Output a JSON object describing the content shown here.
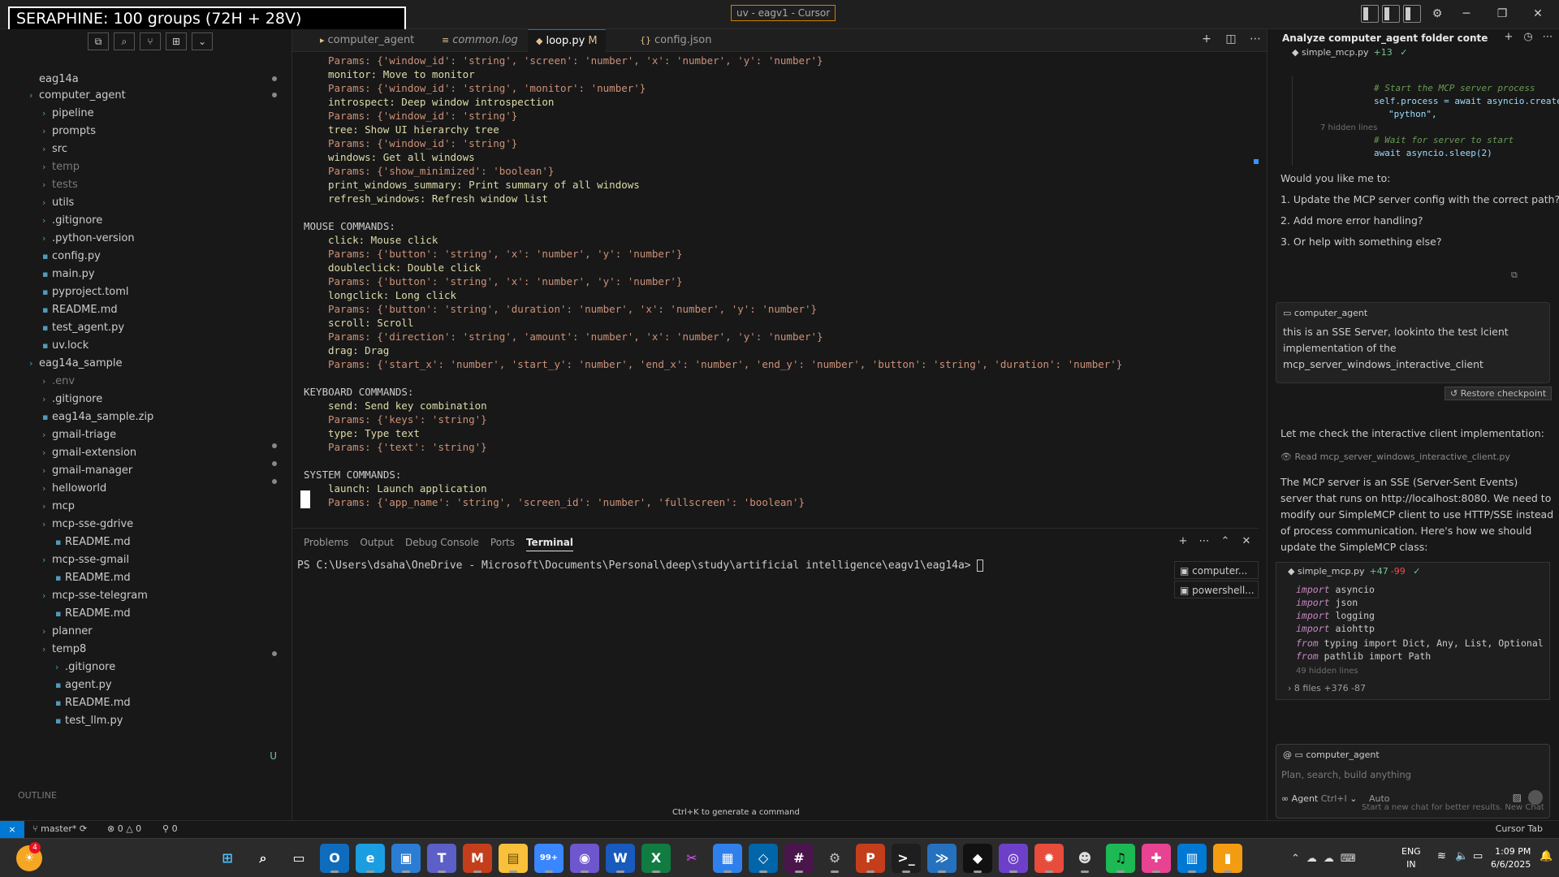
{
  "overlay_title": "SERAPHINE: 100 groups (72H + 28V)",
  "window_title": "uv - eagv1 - Cursor",
  "explorer": {
    "root": "eag14a",
    "items": [
      {
        "label": "computer_agent",
        "muted": false
      },
      {
        "label": "pipeline",
        "muted": false
      },
      {
        "label": "prompts",
        "muted": false
      },
      {
        "label": "src",
        "muted": false
      },
      {
        "label": "temp",
        "muted": true
      },
      {
        "label": "tests",
        "muted": true
      },
      {
        "label": "utils",
        "muted": false
      },
      {
        "label": ".gitignore",
        "muted": false
      },
      {
        "label": ".python-version",
        "muted": false
      },
      {
        "label": "config.py",
        "muted": false
      },
      {
        "label": "main.py",
        "muted": false
      },
      {
        "label": "pyproject.toml",
        "muted": false
      },
      {
        "label": "README.md",
        "muted": false
      },
      {
        "label": "test_agent.py",
        "muted": false
      },
      {
        "label": "uv.lock",
        "muted": false
      },
      {
        "label": "eag14a_sample",
        "muted": false
      },
      {
        "label": ".env",
        "muted": true
      },
      {
        "label": ".gitignore",
        "muted": false
      },
      {
        "label": "eag14a_sample.zip",
        "muted": false
      },
      {
        "label": "gmail-triage",
        "muted": false
      },
      {
        "label": "gmail-extension",
        "muted": false
      },
      {
        "label": "gmail-manager",
        "muted": false
      },
      {
        "label": "helloworld",
        "muted": false
      },
      {
        "label": "mcp",
        "muted": false
      },
      {
        "label": "mcp-sse-gdrive",
        "muted": false
      },
      {
        "label": "README.md",
        "muted": false
      },
      {
        "label": "mcp-sse-gmail",
        "muted": false
      },
      {
        "label": "README.md",
        "muted": false
      },
      {
        "label": "mcp-sse-telegram",
        "muted": false
      },
      {
        "label": "README.md",
        "muted": false
      },
      {
        "label": "planner",
        "muted": false
      },
      {
        "label": "temp8",
        "muted": false
      },
      {
        "label": ".gitignore",
        "muted": false
      },
      {
        "label": "agent.py",
        "muted": false
      },
      {
        "label": "README.md",
        "muted": false
      },
      {
        "label": "test_llm.py",
        "muted": false
      }
    ],
    "outline_label": "OUTLINE",
    "git_untracked": "U"
  },
  "editor_tabs": [
    {
      "label": "computer_agent",
      "active": false,
      "modified": ""
    },
    {
      "label": "common.log",
      "active": false,
      "modified": ""
    },
    {
      "label": "loop.py",
      "active": true,
      "modified": "M"
    },
    {
      "label": "config.json",
      "active": false,
      "modified": ""
    }
  ],
  "code_lines": [
    {
      "text": "Params: {'window_id': 'string', 'screen': 'number', 'x': 'number', 'y': 'number'}",
      "kind": "params"
    },
    {
      "text": "monitor: Move to monitor",
      "kind": "cmd"
    },
    {
      "text": "Params: {'window_id': 'string', 'monitor': 'number'}",
      "kind": "params"
    },
    {
      "text": "introspect: Deep window introspection",
      "kind": "cmd"
    },
    {
      "text": "Params: {'window_id': 'string'}",
      "kind": "params"
    },
    {
      "text": "tree: Show UI hierarchy tree",
      "kind": "cmd"
    },
    {
      "text": "Params: {'window_id': 'string'}",
      "kind": "params"
    },
    {
      "text": "windows: Get all windows",
      "kind": "cmd"
    },
    {
      "text": "Params: {'show_minimized': 'boolean'}",
      "kind": "params"
    },
    {
      "text": "print_windows_summary: Print summary of all windows",
      "kind": "cmd"
    },
    {
      "text": "refresh_windows: Refresh window list",
      "kind": "cmd"
    },
    {
      "text": "",
      "kind": "params"
    },
    {
      "text": "MOUSE COMMANDS:",
      "kind": "hdr"
    },
    {
      "text": "click: Mouse click",
      "kind": "cmd"
    },
    {
      "text": "Params: {'button': 'string', 'x': 'number', 'y': 'number'}",
      "kind": "params"
    },
    {
      "text": "doubleclick: Double click",
      "kind": "cmd"
    },
    {
      "text": "Params: {'button': 'string', 'x': 'number', 'y': 'number'}",
      "kind": "params"
    },
    {
      "text": "longclick: Long click",
      "kind": "cmd"
    },
    {
      "text": "Params: {'button': 'string', 'duration': 'number', 'x': 'number', 'y': 'number'}",
      "kind": "params"
    },
    {
      "text": "scroll: Scroll",
      "kind": "cmd"
    },
    {
      "text": "Params: {'direction': 'string', 'amount': 'number', 'x': 'number', 'y': 'number'}",
      "kind": "params"
    },
    {
      "text": "drag: Drag",
      "kind": "cmd"
    },
    {
      "text": "Params: {'start_x': 'number', 'start_y': 'number', 'end_x': 'number', 'end_y': 'number', 'button': 'string', 'duration': 'number'}",
      "kind": "params"
    },
    {
      "text": "",
      "kind": "params"
    },
    {
      "text": "KEYBOARD COMMANDS:",
      "kind": "hdr"
    },
    {
      "text": "send: Send key combination",
      "kind": "cmd"
    },
    {
      "text": "Params: {'keys': 'string'}",
      "kind": "params"
    },
    {
      "text": "type: Type text",
      "kind": "cmd"
    },
    {
      "text": "Params: {'text': 'string'}",
      "kind": "params"
    },
    {
      "text": "",
      "kind": "params"
    },
    {
      "text": "SYSTEM COMMANDS:",
      "kind": "hdr"
    },
    {
      "text": "launch: Launch application",
      "kind": "cmd"
    },
    {
      "text": "Params: {'app_name': 'string', 'screen_id': 'number', 'fullscreen': 'boolean'}",
      "kind": "params"
    }
  ],
  "generate_hint": "Ctrl+K to generate a command",
  "panel": {
    "tabs": [
      "Problems",
      "Output",
      "Debug Console",
      "Ports",
      "Terminal"
    ],
    "active_tab": "Terminal",
    "terminal_prompt": "PS C:\\Users\\dsaha\\OneDrive - Microsoft\\Documents\\Personal\\deep\\study\\artificial intelligence\\eagv1\\eag14a>",
    "terminals": [
      "computer...",
      "powershell..."
    ]
  },
  "chat": {
    "title": "Analyze computer_agent folder conte",
    "file1": {
      "name": "simple_mcp.py",
      "add": "+13",
      "check": "✓"
    },
    "diff_lines": [
      {
        "text": "# Start the MCP server process",
        "code": false
      },
      {
        "text": "self.process = await asyncio.create_",
        "code": true
      },
      {
        "text": "\"python\",",
        "code": true
      },
      {
        "text": "# Wait for server to start",
        "code": false
      },
      {
        "text": "await asyncio.sleep(2)",
        "code": true
      }
    ],
    "hidden_lines": "7 hidden lines",
    "followup_intro": "Would you like me to:",
    "followups": [
      "1. Update the MCP server config with the correct path?",
      "2. Add more error handling?",
      "3. Or help with something else?"
    ],
    "user_context": "computer_agent",
    "user_message": [
      "this is an SSE Server, lookinto the test lcient",
      "implementation of the",
      "mcp_server_windows_interactive_client"
    ],
    "restore_label": "Restore checkpoint",
    "reply1": "Let me check the interactive client implementation:",
    "read_file": "Read mcp_server_windows_interactive_client.py",
    "reply2": [
      "The MCP server is an SSE (Server-Sent Events)",
      "server that runs on http://localhost:8080. We need to",
      "modify our SimpleMCP client to use HTTP/SSE instead",
      "of process communication. Here's how we should",
      "update the SimpleMCP class:"
    ],
    "file2": {
      "name": "simple_mcp.py",
      "add": "+47",
      "del": "-99",
      "check": "✓"
    },
    "code_block": [
      {
        "kw": "import",
        "rest": "asyncio"
      },
      {
        "kw": "import",
        "rest": "json"
      },
      {
        "kw": "import",
        "rest": "logging"
      },
      {
        "kw": "import",
        "rest": "aiohttp"
      },
      {
        "kw": "from",
        "rest": "typing import Dict, Any, List, Optional"
      },
      {
        "kw": "from",
        "rest": "pathlib import Path"
      }
    ],
    "code_hidden_lines": "49 hidden lines",
    "files_changed": "8 files +376 -87",
    "input_context": "computer_agent",
    "input_placeholder": "Plan, search, build anything",
    "agent_label": "Agent",
    "agent_shortcut": "Ctrl+I",
    "auto_label": "Auto",
    "new_chat_hint": "Start a new chat for better results. New Chat"
  },
  "statusbar": {
    "branch": "master*",
    "problems": "0 △ 0",
    "ports": "0",
    "right": "Cursor Tab"
  },
  "taskbar": {
    "weather_badge": "4",
    "apps": [
      {
        "name": "windows-start",
        "glyph": "⊞",
        "bg": "#2b2b2b",
        "fg": "#4cc2ff",
        "running": false
      },
      {
        "name": "search",
        "glyph": "⌕",
        "bg": "#2b2b2b",
        "fg": "#ffffff",
        "running": false
      },
      {
        "name": "task-view",
        "glyph": "▭",
        "bg": "#2b2b2b",
        "fg": "#ffffff",
        "running": false
      },
      {
        "name": "outlook",
        "glyph": "O",
        "bg": "#0f6cbd",
        "fg": "#ffffff",
        "running": true
      },
      {
        "name": "edge",
        "glyph": "e",
        "bg": "#1b9de2",
        "fg": "#ffffff",
        "running": true
      },
      {
        "name": "app6",
        "glyph": "▣",
        "bg": "#2b7cd3",
        "fg": "#ffffff",
        "running": true
      },
      {
        "name": "teams",
        "glyph": "T",
        "bg": "#5b5fc7",
        "fg": "#ffffff",
        "running": true
      },
      {
        "name": "m365",
        "glyph": "M",
        "bg": "#c43e1c",
        "fg": "#ffffff",
        "running": true
      },
      {
        "name": "explorer",
        "glyph": "▤",
        "bg": "#f8c03b",
        "fg": "#6b4a00",
        "running": true
      },
      {
        "name": "chat-99",
        "glyph": "99+",
        "bg": "#3a86ff",
        "fg": "#ffffff",
        "running": true
      },
      {
        "name": "copilot",
        "glyph": "◉",
        "bg": "#6e56cf",
        "fg": "#ffffff",
        "running": true
      },
      {
        "name": "word",
        "glyph": "W",
        "bg": "#185abd",
        "fg": "#ffffff",
        "running": true
      },
      {
        "name": "excel",
        "glyph": "X",
        "bg": "#107c41",
        "fg": "#ffffff",
        "running": true
      },
      {
        "name": "snip",
        "glyph": "✂",
        "bg": "#2b2b2b",
        "fg": "#e056fd",
        "running": false
      },
      {
        "name": "whiteboard",
        "glyph": "▦",
        "bg": "#2f80ed",
        "fg": "#ffffff",
        "running": true
      },
      {
        "name": "vscode",
        "glyph": "◇",
        "bg": "#0065a9",
        "fg": "#ffffff",
        "running": true
      },
      {
        "name": "slack",
        "glyph": "#",
        "bg": "#4a154b",
        "fg": "#ffffff",
        "running": true
      },
      {
        "name": "settings",
        "glyph": "⚙",
        "bg": "#2b2b2b",
        "fg": "#c0c0c0",
        "running": true
      },
      {
        "name": "powerpoint",
        "glyph": "P",
        "bg": "#c43e1c",
        "fg": "#ffffff",
        "running": true
      },
      {
        "name": "terminal",
        "glyph": ">_",
        "bg": "#1e1e1e",
        "fg": "#ffffff",
        "running": true
      },
      {
        "name": "powershell",
        "glyph": "≫",
        "bg": "#2671be",
        "fg": "#ffffff",
        "running": true
      },
      {
        "name": "cursor",
        "glyph": "◆",
        "bg": "#111111",
        "fg": "#ffffff",
        "running": true
      },
      {
        "name": "github",
        "glyph": "◎",
        "bg": "#6e40c9",
        "fg": "#ffffff",
        "running": true
      },
      {
        "name": "app24",
        "glyph": "✹",
        "bg": "#e74c3c",
        "fg": "#ffffff",
        "running": true
      },
      {
        "name": "gimp",
        "glyph": "☻",
        "bg": "#2b2b2b",
        "fg": "#dddddd",
        "running": true
      },
      {
        "name": "spotify",
        "glyph": "♫",
        "bg": "#1db954",
        "fg": "#000000",
        "running": true
      },
      {
        "name": "app27",
        "glyph": "✚",
        "bg": "#e84393",
        "fg": "#ffffff",
        "running": true
      },
      {
        "name": "rdp",
        "glyph": "▥",
        "bg": "#0078d4",
        "fg": "#ffffff",
        "running": true
      },
      {
        "name": "app29",
        "glyph": "▮",
        "bg": "#f39c12",
        "fg": "#ffffff",
        "running": true
      }
    ],
    "lang_top": "ENG",
    "lang_bottom": "IN",
    "time": "1:09 PM",
    "date": "6/6/2025"
  }
}
